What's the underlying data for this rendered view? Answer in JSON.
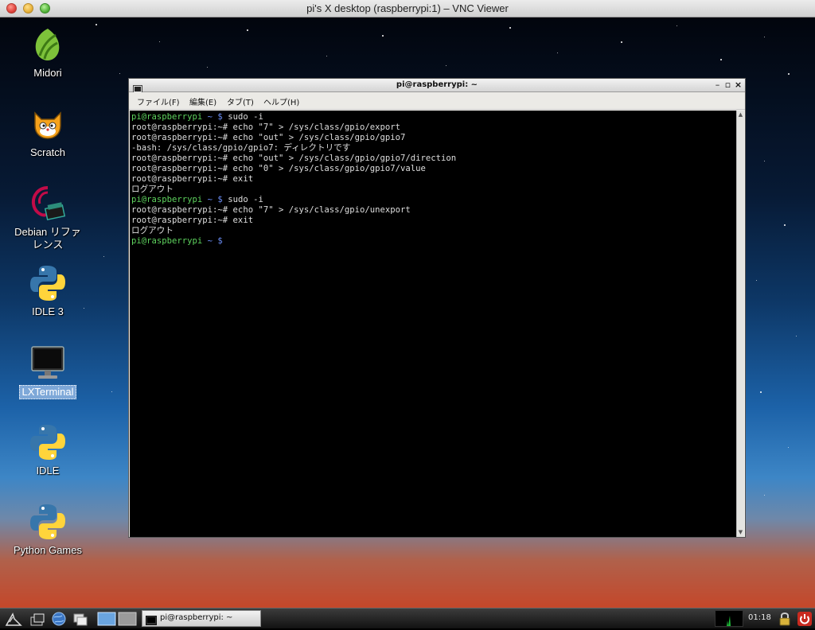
{
  "window": {
    "title": "pi's X desktop (raspberrypi:1) – VNC Viewer"
  },
  "desktop": {
    "icons": [
      {
        "name": "midori",
        "label": "Midori"
      },
      {
        "name": "scratch",
        "label": "Scratch"
      },
      {
        "name": "debian-reference",
        "label": "Debian リファ\nレンス"
      },
      {
        "name": "idle-3",
        "label": "IDLE 3"
      },
      {
        "name": "lxterminal",
        "label": "LXTerminal",
        "selected": true
      },
      {
        "name": "idle",
        "label": "IDLE"
      },
      {
        "name": "python-games",
        "label": "Python Games"
      }
    ]
  },
  "terminal": {
    "title": "pi@raspberrypi: ~",
    "menu": [
      "ファイル(F)",
      "編集(E)",
      "タブ(T)",
      "ヘルプ(H)"
    ],
    "lines": [
      {
        "prompt": "pi@raspberrypi",
        "path": " ~ $",
        "cmd": " sudo -i"
      },
      {
        "text": "root@raspberrypi:~# echo \"7\" > /sys/class/gpio/export"
      },
      {
        "text": "root@raspberrypi:~# echo \"out\" > /sys/class/gpio/gpio7"
      },
      {
        "text": "-bash: /sys/class/gpio/gpio7: ディレクトリです"
      },
      {
        "text": "root@raspberrypi:~# echo \"out\" > /sys/class/gpio/gpio7/direction"
      },
      {
        "text": "root@raspberrypi:~# echo \"0\" > /sys/class/gpio/gpio7/value"
      },
      {
        "text": "root@raspberrypi:~# exit"
      },
      {
        "text": "ログアウト"
      },
      {
        "prompt": "pi@raspberrypi",
        "path": " ~ $",
        "cmd": " sudo -i"
      },
      {
        "text": "root@raspberrypi:~# echo \"7\" > /sys/class/gpio/unexport"
      },
      {
        "text": "root@raspberrypi:~# exit"
      },
      {
        "text": "ログアウト"
      },
      {
        "prompt": "pi@raspberrypi",
        "path": " ~ $",
        "cmd": " "
      }
    ]
  },
  "taskbar": {
    "task_label": "pi@raspberrypi: ~",
    "clock": "01:18"
  },
  "colors": {
    "prompt_green": "#5ed35e",
    "prompt_blue": "#6a8cf4",
    "terminal_bg": "#000000"
  }
}
